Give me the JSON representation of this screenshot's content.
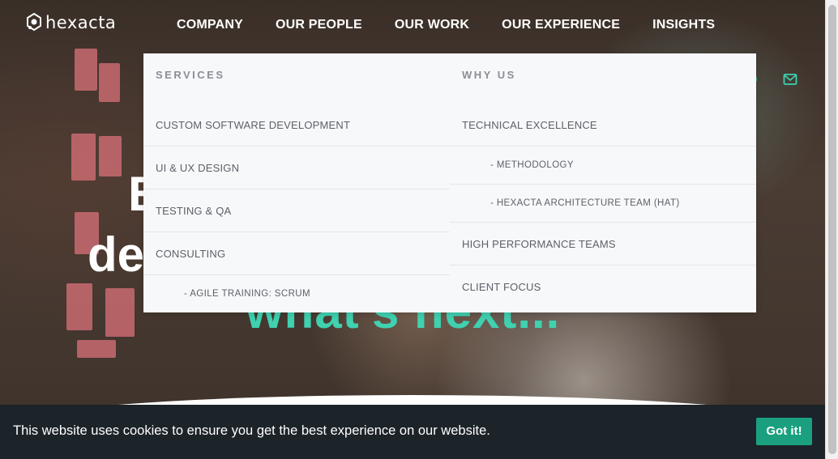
{
  "brand": {
    "name": "hexacta"
  },
  "nav": {
    "items": [
      "COMPANY",
      "OUR PEOPLE",
      "OUR WORK",
      "OUR EXPERIENCE",
      "INSIGHTS"
    ]
  },
  "dropdown": {
    "services": {
      "heading": "SERVICES",
      "items": [
        {
          "label": "CUSTOM SOFTWARE DEVELOPMENT",
          "sub": false
        },
        {
          "label": "UI & UX DESIGN",
          "sub": false
        },
        {
          "label": "TESTING & QA",
          "sub": false
        },
        {
          "label": "CONSULTING",
          "sub": false
        },
        {
          "label": "- AGILE TRAINING: SCRUM",
          "sub": true
        }
      ]
    },
    "why_us": {
      "heading": "WHY US",
      "items": [
        {
          "label": "TECHNICAL EXCELLENCE",
          "sub": false
        },
        {
          "label": "- METHODOLOGY",
          "sub": true
        },
        {
          "label": "- HEXACTA ARCHITECTURE TEAM (HAT)",
          "sub": true
        },
        {
          "label": "HIGH PERFORMANCE TEAMS",
          "sub": false
        },
        {
          "label": "CLIENT FOCUS",
          "sub": false
        }
      ]
    }
  },
  "hero": {
    "line1": "E",
    "line2": "de",
    "line3": "what's next..."
  },
  "cookie": {
    "message": "This website uses cookies to ensure you get the best experience on our website.",
    "button": "Got it!"
  },
  "colors": {
    "accent": "#3fd1b0",
    "cookie_bg": "#1c2329",
    "button": "#1aa07f"
  },
  "icons": [
    "hexacta-logo-icon",
    "mail-icon"
  ]
}
